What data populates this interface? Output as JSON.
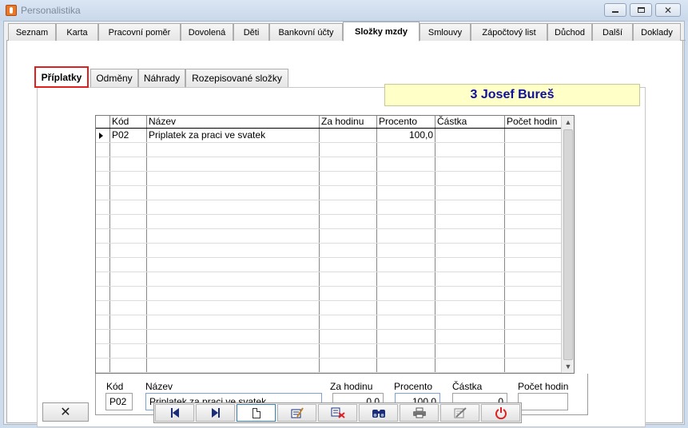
{
  "window": {
    "title": "Personalistika"
  },
  "main_tabs": [
    {
      "label": "Seznam",
      "active": false
    },
    {
      "label": "Karta",
      "active": false
    },
    {
      "label": "Pracovní poměr",
      "active": false
    },
    {
      "label": "Dovolená",
      "active": false
    },
    {
      "label": "Děti",
      "active": false
    },
    {
      "label": "Bankovní účty",
      "active": false
    },
    {
      "label": "Složky mzdy",
      "active": true
    },
    {
      "label": "Smlouvy",
      "active": false
    },
    {
      "label": "Zápočtový list",
      "active": false
    },
    {
      "label": "Důchod",
      "active": false
    },
    {
      "label": "Další",
      "active": false
    },
    {
      "label": "Doklady",
      "active": false
    }
  ],
  "sub_tabs": [
    {
      "label": "Příplatky",
      "active": true
    },
    {
      "label": "Odměny",
      "active": false
    },
    {
      "label": "Náhrady",
      "active": false
    },
    {
      "label": "Rozepisované složky",
      "active": false
    }
  ],
  "employee": {
    "display": "3 Josef Bureš"
  },
  "grid": {
    "columns": [
      "Kód",
      "Název",
      "Za hodinu",
      "Procento",
      "Částka",
      "Počet hodin"
    ],
    "rows": [
      {
        "kod": "P02",
        "nazev": "Priplatek za praci ve svatek",
        "za_hodinu": "",
        "procento": "100,0",
        "castka": "",
        "pocet_hodin": "",
        "current": true
      }
    ]
  },
  "detail": {
    "kod_label": "Kód",
    "kod_value": "P02",
    "nazev_label": "Název",
    "nazev_value": "Priplatek za praci ve svatek",
    "za_hodinu_label": "Za hodinu",
    "za_hodinu_value": "0,0",
    "procento_label": "Procento",
    "procento_value": "100,0",
    "castka_label": "Částka",
    "castka_value": "0",
    "pocet_hodin_label": "Počet hodin",
    "pocet_hodin_value": ""
  },
  "toolbar": {
    "cancel_icon": "close-x-icon",
    "buttons": [
      "first-record-icon",
      "last-record-icon",
      "new-record-icon",
      "edit-record-icon",
      "delete-record-icon",
      "search-icon",
      "print-icon",
      "settings-icon",
      "power-icon"
    ]
  },
  "colors": {
    "employee_bg": "#ffffc8",
    "employee_text": "#10109a",
    "active_subtab_border": "#e02020",
    "nav_icon": "#1a2c7a",
    "power_icon": "#e02020"
  }
}
